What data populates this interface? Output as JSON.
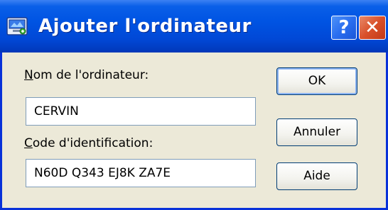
{
  "window": {
    "title": "Ajouter l'ordinateur",
    "help_label": "?",
    "close_label": "✕"
  },
  "form": {
    "name_label_hotkey": "N",
    "name_label_rest": "om de l'ordinateur:",
    "name_value": "CERVIN",
    "code_label_hotkey": "C",
    "code_label_rest": "ode d'identification:",
    "code_value": "N60D Q343 EJ8K ZA7E"
  },
  "buttons": {
    "ok_label": "OK",
    "cancel_label": "Annuler",
    "help_label": "Aide"
  },
  "icons": {
    "title_icon": "computer-add-icon",
    "help_icon": "help-icon",
    "close_icon": "close-icon"
  },
  "colors": {
    "titlebar": "#0054e3",
    "frame": "#0831d9",
    "dialog_bg": "#ece9d8",
    "close_button": "#d9502a",
    "button_border": "#003c74"
  }
}
